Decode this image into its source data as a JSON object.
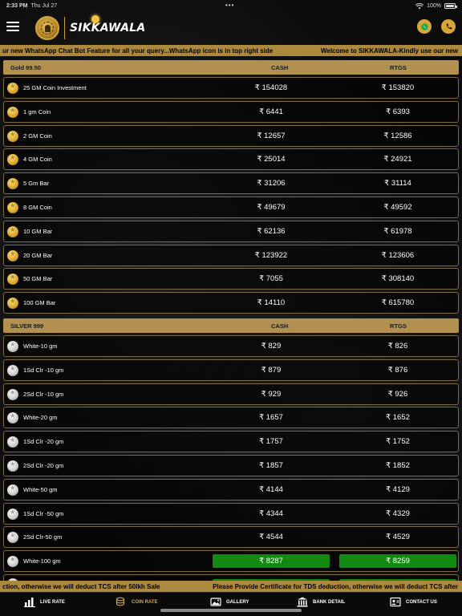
{
  "status_bar": {
    "time": "2:33 PM",
    "date": "Thu Jul 27",
    "battery": "100%"
  },
  "header": {
    "brand": "SIKKAWALA",
    "whatsapp_icon": "whatsapp-icon",
    "phone_icon": "phone-icon"
  },
  "ticker_top": {
    "left": "ur new WhatsApp Chat Bot Feature for all your query...WhatsApp icon is in top right side",
    "right": "Welcome to SIKKAWALA-Kindly use our new"
  },
  "ticker_bottom": {
    "left": "ction, otherwise we will deduct TCS after 50lkh Sale",
    "right": "Please Provide Certificate for TDS deduction, otherwise we will deduct TCS after"
  },
  "gold": {
    "title": "Gold 99.50",
    "cash_label": "CASH",
    "rtgs_label": "RTGS",
    "items": [
      {
        "name": "25 GM Coin Investment",
        "cash": "₹ 154028",
        "rtgs": "₹ 153820"
      },
      {
        "name": "1 gm Coin",
        "cash": "₹ 6441",
        "rtgs": "₹ 6393"
      },
      {
        "name": "2 GM Coin",
        "cash": "₹ 12657",
        "rtgs": "₹ 12586"
      },
      {
        "name": "4 GM Coin",
        "cash": "₹ 25014",
        "rtgs": "₹ 24921"
      },
      {
        "name": "5 Gm Bar",
        "cash": "₹ 31206",
        "rtgs": "₹ 31114"
      },
      {
        "name": "8 GM Coin",
        "cash": "₹ 49679",
        "rtgs": "₹ 49592"
      },
      {
        "name": "10 GM Bar",
        "cash": "₹ 62136",
        "rtgs": "₹ 61978"
      },
      {
        "name": "20 GM Bar",
        "cash": "₹ 123922",
        "rtgs": "₹ 123606"
      },
      {
        "name": "50 GM Bar",
        "cash": "₹ 7055",
        "rtgs": "₹ 308140"
      },
      {
        "name": "100 GM Bar",
        "cash": "₹ 14110",
        "rtgs": "₹ 615780"
      }
    ]
  },
  "silver": {
    "title": "SILVER 999",
    "cash_label": "CASH",
    "rtgs_label": "RTGS",
    "items": [
      {
        "name": "White-10 gm",
        "cash": "₹ 829",
        "rtgs": "₹ 826"
      },
      {
        "name": "1Sd Clr -10 gm",
        "cash": "₹ 879",
        "rtgs": "₹ 876"
      },
      {
        "name": "2Sd Clr -10 gm",
        "cash": "₹ 929",
        "rtgs": "₹ 926"
      },
      {
        "name": "White-20 gm",
        "cash": "₹ 1657",
        "rtgs": "₹ 1652"
      },
      {
        "name": "1Sd Clr -20 gm",
        "cash": "₹ 1757",
        "rtgs": "₹ 1752"
      },
      {
        "name": "2Sd Clr -20 gm",
        "cash": "₹ 1857",
        "rtgs": "₹ 1852"
      },
      {
        "name": "White-50 gm",
        "cash": "₹ 4144",
        "rtgs": "₹ 4129"
      },
      {
        "name": "1Sd Clr -50 gm",
        "cash": "₹ 4344",
        "rtgs": "₹ 4329"
      },
      {
        "name": "2Sd Clr-50 gm",
        "cash": "₹ 4544",
        "rtgs": "₹ 4529"
      },
      {
        "name": "White-100 gm",
        "cash": "₹ 8287",
        "rtgs": "₹ 8259",
        "highlight": true
      }
    ]
  },
  "tabs": [
    {
      "label": "LIVE RATE",
      "icon": "bar-chart-icon"
    },
    {
      "label": "COIN RATE",
      "icon": "coin-stack-icon",
      "active": true
    },
    {
      "label": "GALLERY",
      "icon": "image-icon"
    },
    {
      "label": "BANK DETAIL",
      "icon": "bank-icon"
    },
    {
      "label": "CONTACT US",
      "icon": "contact-card-icon"
    }
  ],
  "colors": {
    "gold_bar": "#b29150",
    "ticker": "#ad8940",
    "highlight_green": "#128a12",
    "accent": "#d9a53a"
  }
}
